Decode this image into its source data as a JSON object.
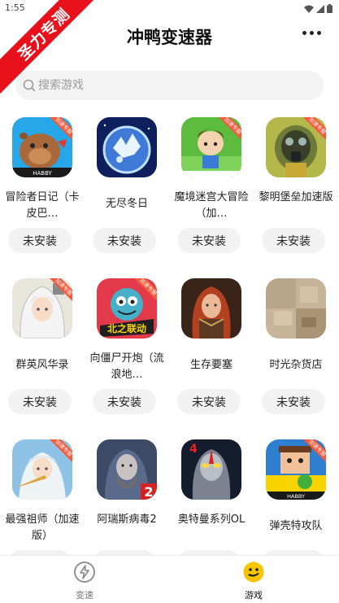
{
  "status_bar": {
    "time": "1:55"
  },
  "ribbon": {
    "text": "圣力专测"
  },
  "header": {
    "title": "冲鸭变速器"
  },
  "search": {
    "placeholder": "搜索游戏"
  },
  "games": [
    {
      "name": "冒险者日记（卡皮巴…",
      "button": "未安装",
      "icon": "capybara-icon",
      "badge": "加速专服"
    },
    {
      "name": "无尽冬日",
      "button": "未安装",
      "icon": "frozen-planet-icon"
    },
    {
      "name": "魔境迷宫大冒险（加…",
      "button": "未安装",
      "icon": "adventure-boy-icon",
      "badge": "加速专服"
    },
    {
      "name": "黎明堡垒加速版",
      "button": "未安装",
      "icon": "gas-mask-icon",
      "badge": "加速专服"
    },
    {
      "name": "群英风华录",
      "button": "未安装",
      "icon": "white-hair-girl-icon",
      "badge": "加速专服"
    },
    {
      "name": "向僵尸开炮（流浪地…",
      "button": "未安装",
      "icon": "zombie-cannon-icon",
      "badge": "加速专服",
      "art_text": "北之联动"
    },
    {
      "name": "生存要塞",
      "button": "未安装",
      "icon": "red-hair-warrior-icon"
    },
    {
      "name": "时光杂货店",
      "button": "未安装",
      "icon": "blurred-shop-icon"
    },
    {
      "name": "最强祖师（加速版）",
      "button": "未安装",
      "icon": "anime-girl-icon",
      "badge": "加速专服"
    },
    {
      "name": "阿瑞斯病毒2",
      "button": "未安装",
      "icon": "bearded-man-icon",
      "art_text": "2"
    },
    {
      "name": "奥特曼系列OL",
      "button": "未安装",
      "icon": "ultraman-icon",
      "art_text": "4"
    },
    {
      "name": "弹壳特攻队",
      "button": "未安装",
      "icon": "survivor-icon",
      "badge": "加速专服"
    }
  ],
  "tabs": [
    {
      "label": "变速",
      "icon": "lightning-icon"
    },
    {
      "label": "游戏",
      "icon": "gamepad-duck-icon"
    }
  ],
  "colors": {
    "ribbon": "#e8101a",
    "accent": "#f7c400",
    "button_bg": "#f2f2f2",
    "badge": "#f45a3c"
  }
}
